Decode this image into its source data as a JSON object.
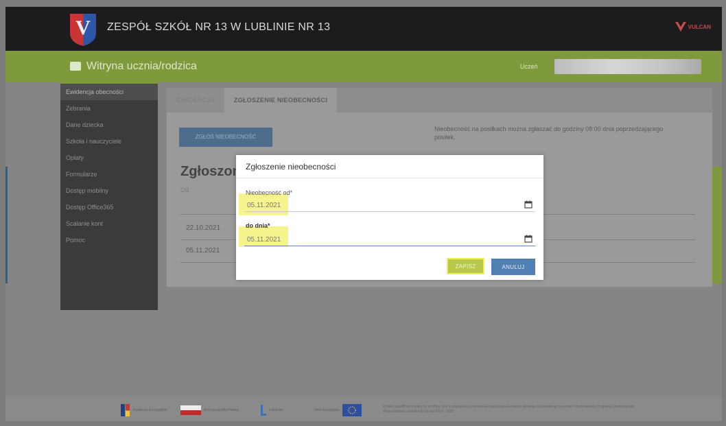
{
  "header": {
    "school_title": "ZESPÓŁ SZKÓŁ NR 13 W LUBLINIE NR 13",
    "brand": "VULCAN",
    "crest_letter": "V"
  },
  "portal": {
    "title": "Witryna ucznia/rodzica",
    "user_label": "Uczeń"
  },
  "sidebar": {
    "items": [
      {
        "label": "Ewidencja obecności"
      },
      {
        "label": "Zebrania"
      },
      {
        "label": "Dane dziecka"
      },
      {
        "label": "Szkoła i nauczyciele"
      },
      {
        "label": "Opłaty"
      },
      {
        "label": "Formularze"
      },
      {
        "label": "Dostęp mobilny"
      },
      {
        "label": "Dostęp Office365"
      },
      {
        "label": "Scalanie kont"
      },
      {
        "label": "Pomoc"
      }
    ]
  },
  "tabs": [
    {
      "label": "EWIDENCJA"
    },
    {
      "label": "ZGŁOSZENIE NIEOBECNOŚCI"
    }
  ],
  "panel": {
    "report_button": "ZGŁOŚ NIEOBECNOŚĆ",
    "info": "Nieobecność na posiłkach można zgłaszać do godziny 08:00 dnia poprzedzającego posiłek.",
    "heading": "Zgłoszon",
    "table_head": "Od",
    "rows": [
      {
        "date": "22.10.2021"
      },
      {
        "date": "05.11.2021"
      }
    ]
  },
  "modal": {
    "title": "Zgłoszenie nieobecności",
    "from_label": "Nieobecność od*",
    "from_value": "05.11.2021",
    "to_label": "do dnia*",
    "to_value": "05.11.2021",
    "save": "ZAPISZ",
    "cancel": "ANULUJ"
  },
  "footer": {
    "logos": [
      "Fundusze Europejskie",
      "Rzeczpospolita Polska",
      "Lubelskie",
      "Unia Europejska"
    ],
    "text": "Projekt współfinansowany ze środków Unii Europejskiej w ramach Europejskiego Funduszu Rozwoju Regionalnego w ramach Regionalnego Programu Operacyjnego Województwa Lubelskiego na lata 2014 - 2020"
  },
  "colors": {
    "header": "#1c1c1e",
    "accent_green": "#7f9a3d",
    "button_blue": "#4f7fb3",
    "highlight": "#f4f27a"
  }
}
